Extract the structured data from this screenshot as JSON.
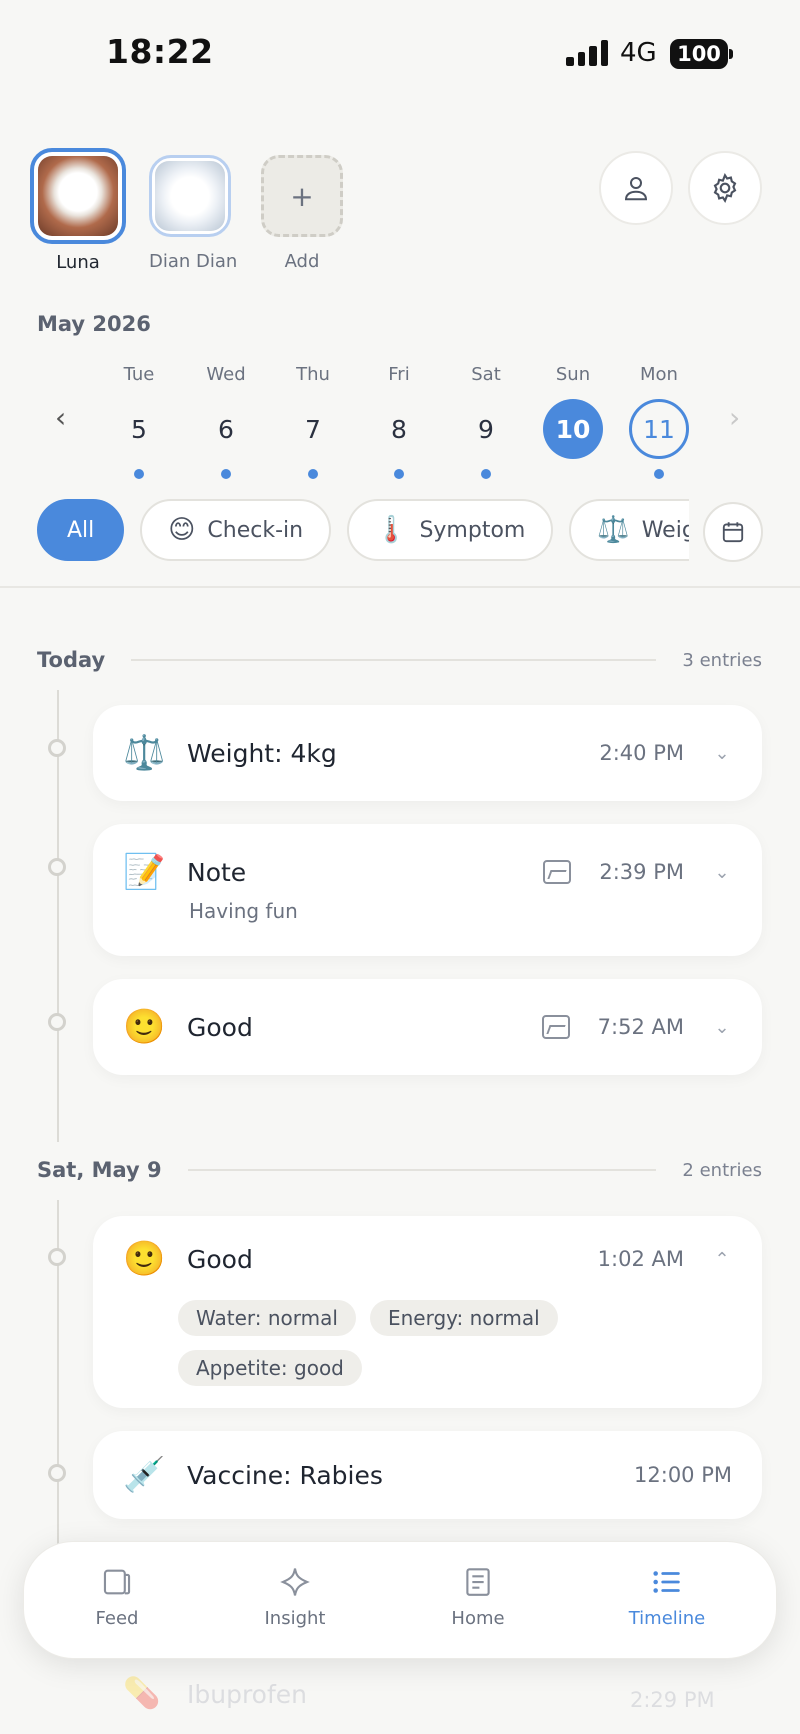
{
  "status_bar": {
    "time": "18:22",
    "network": "4G",
    "battery": "100"
  },
  "pets": [
    {
      "name": "Luna",
      "selected": true
    },
    {
      "name": "Dian Dian",
      "selected": false
    },
    {
      "name": "Add",
      "selected": false
    }
  ],
  "calendar": {
    "month": "May 2026",
    "days": [
      {
        "name": "Tue",
        "num": "5",
        "has_entries": true
      },
      {
        "name": "Wed",
        "num": "6",
        "has_entries": true
      },
      {
        "name": "Thu",
        "num": "7",
        "has_entries": true
      },
      {
        "name": "Fri",
        "num": "8",
        "has_entries": true
      },
      {
        "name": "Sat",
        "num": "9",
        "has_entries": true
      },
      {
        "name": "Sun",
        "num": "10",
        "state": "selected"
      },
      {
        "name": "Mon",
        "num": "11",
        "state": "today",
        "has_entries": true
      }
    ]
  },
  "filters": [
    {
      "label": "All",
      "active": true
    },
    {
      "label": "Check-in",
      "icon": "😊"
    },
    {
      "label": "Symptom",
      "icon": "🌡️"
    },
    {
      "label": "Weig",
      "icon": "⚖️"
    }
  ],
  "sections": [
    {
      "title": "Today",
      "count": "3 entries",
      "entries": [
        {
          "icon": "⚖️",
          "title": "Weight: 4kg",
          "time": "2:40 PM",
          "has_image": false
        },
        {
          "icon": "📝",
          "title": "Note",
          "subtitle": "Having fun",
          "time": "2:39 PM",
          "has_image": true
        },
        {
          "icon": "🙂",
          "title": "Good",
          "time": "7:52 AM",
          "has_image": true
        }
      ]
    },
    {
      "title": "Sat, May 9",
      "count": "2 entries",
      "entries": [
        {
          "icon": "🙂",
          "title": "Good",
          "time": "1:02 AM",
          "expanded": true,
          "tags": [
            "Water: normal",
            "Energy: normal",
            "Appetite: good"
          ]
        },
        {
          "icon": "💉",
          "title": "Vaccine: Rabies",
          "time": "12:00 PM"
        }
      ]
    }
  ],
  "peek_entry": {
    "icon": "💊",
    "title": "Ibuprofen",
    "time": "2:29 PM"
  },
  "tabs": [
    {
      "label": "Feed"
    },
    {
      "label": "Insight"
    },
    {
      "label": "Home"
    },
    {
      "label": "Timeline",
      "active": true
    }
  ],
  "colors": {
    "accent": "#4a89dc",
    "background": "#f7f7f5",
    "card": "#ffffff"
  }
}
